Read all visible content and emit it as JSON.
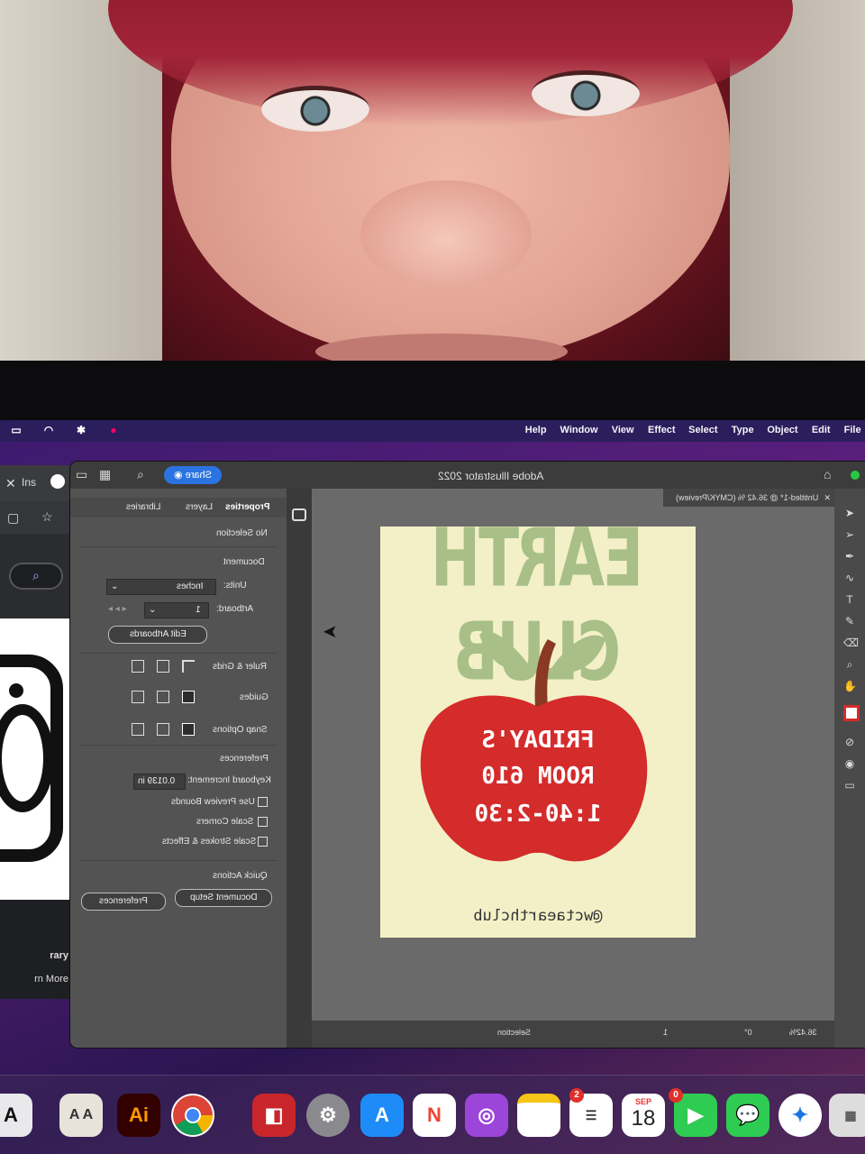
{
  "menubar": {
    "menus": [
      "File",
      "Edit",
      "Object",
      "Type",
      "Select",
      "Effect",
      "View",
      "Window",
      "Help"
    ],
    "icons": [
      "apple-icon",
      "wifi-icon",
      "bluetooth-icon",
      "battery-icon"
    ]
  },
  "browser": {
    "tab_label": "Ins",
    "bottom_line1": "rary",
    "bottom_line2": "rn More"
  },
  "illustrator": {
    "window_title": "Adobe Illustrator 2022",
    "share_label": "Share",
    "doc_tab": "Untitled-1* @ 36.42 % (CMYK/Preview)",
    "panel_tabs": [
      "Properties",
      "Layers",
      "Libraries"
    ],
    "properties": {
      "selection": "No Selection",
      "document_heading": "Document",
      "units_label": "Units:",
      "units_value": "Inches",
      "artboard_label": "Artboard:",
      "artboard_value": "1",
      "edit_artboards": "Edit Artboards",
      "ruler_grids": "Ruler & Grids",
      "guides": "Guides",
      "snap_options": "Snap Options",
      "preferences_heading": "Preferences",
      "keyboard_increment_label": "Keyboard Increment:",
      "keyboard_increment_value": "0.0139 in",
      "use_preview_bounds": "Use Preview Bounds",
      "scale_corners": "Scale Corners",
      "scale_strokes": "Scale Strokes & Effects",
      "quick_actions": "Quick Actions",
      "document_setup": "Document Setup",
      "preferences_btn": "Preferences"
    },
    "artboard": {
      "headline": "EARTH CLUB",
      "line1": "FRIDAY'S",
      "line2": "ROOM 610",
      "line3": "1:40-2:30",
      "handle": "@wctaearthclub",
      "colors": {
        "background": "#f3f0c7",
        "apple": "#d42b2b",
        "leaf": "#a8bf88",
        "stem": "#8a3a22"
      }
    },
    "statusbar": {
      "zoom": "36.42%",
      "rotation": "0°",
      "artboard_num": "1",
      "tool": "Selection"
    }
  },
  "dock": {
    "calendar_month": "SEP",
    "calendar_day": "18",
    "facetime_badge": "0",
    "reminders_badge": "2",
    "illustrator_label": "Ai"
  }
}
